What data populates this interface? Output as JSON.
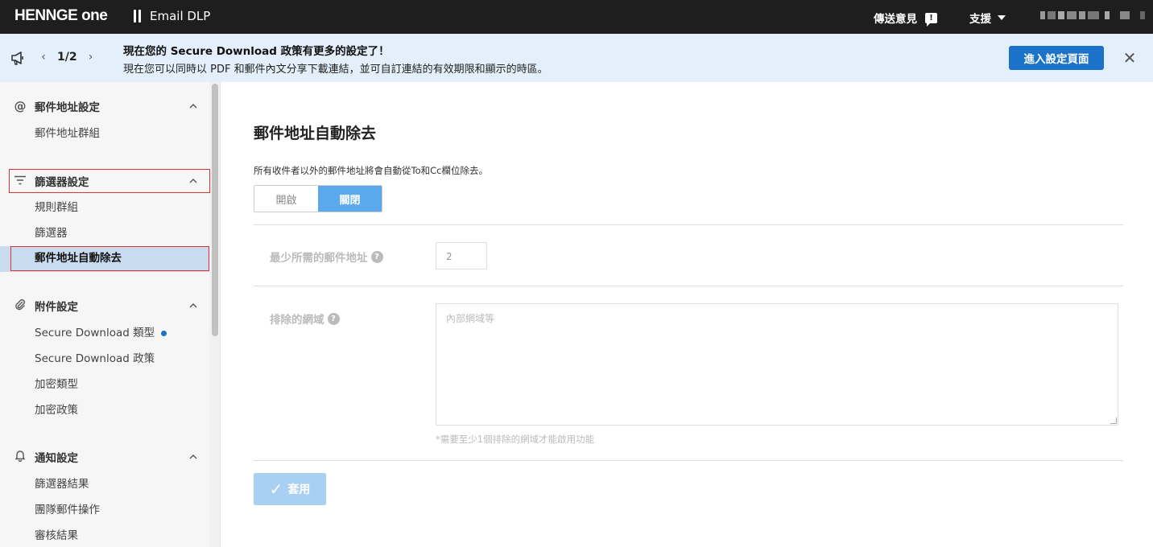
{
  "topbar": {
    "logo": "HENNGE one",
    "app_name": "Email DLP",
    "feedback_label": "傳送意見",
    "support_label": "支援"
  },
  "banner": {
    "pager": "1/2",
    "title": "現在您的 Secure Download 政策有更多的設定了！",
    "text": "現在您可以同時以 PDF 和郵件內文分享下載連結，並可自訂連結的有效期限和顯示的時區。",
    "button_label": "進入設定頁面"
  },
  "sidebar": {
    "sections": [
      {
        "label": "郵件地址設定",
        "icon": "at-icon",
        "items": [
          "郵件地址群組"
        ]
      },
      {
        "label": "篩選器設定",
        "icon": "filter-icon",
        "items": [
          "規則群組",
          "篩選器",
          "郵件地址自動除去"
        ]
      },
      {
        "label": "附件設定",
        "icon": "paperclip-icon",
        "items": [
          "Secure Download 類型",
          "Secure Download 政策",
          "加密類型",
          "加密政策"
        ]
      },
      {
        "label": "通知設定",
        "icon": "bell-icon",
        "items": [
          "篩選器結果",
          "團隊郵件操作",
          "審核結果"
        ]
      }
    ]
  },
  "main": {
    "title": "郵件地址自動除去",
    "description": "所有收件者以外的郵件地址將會自動從To和Cc欄位除去。",
    "toggle": {
      "on_label": "開啟",
      "off_label": "關閉",
      "selected": "關閉"
    },
    "min_label": "最少所需的郵件地址",
    "min_value": "2",
    "excluded_label": "排除的網域",
    "excluded_placeholder": "內部網域等",
    "note": "*需要至少1個排除的網域才能啟用功能",
    "apply_label": "套用"
  }
}
